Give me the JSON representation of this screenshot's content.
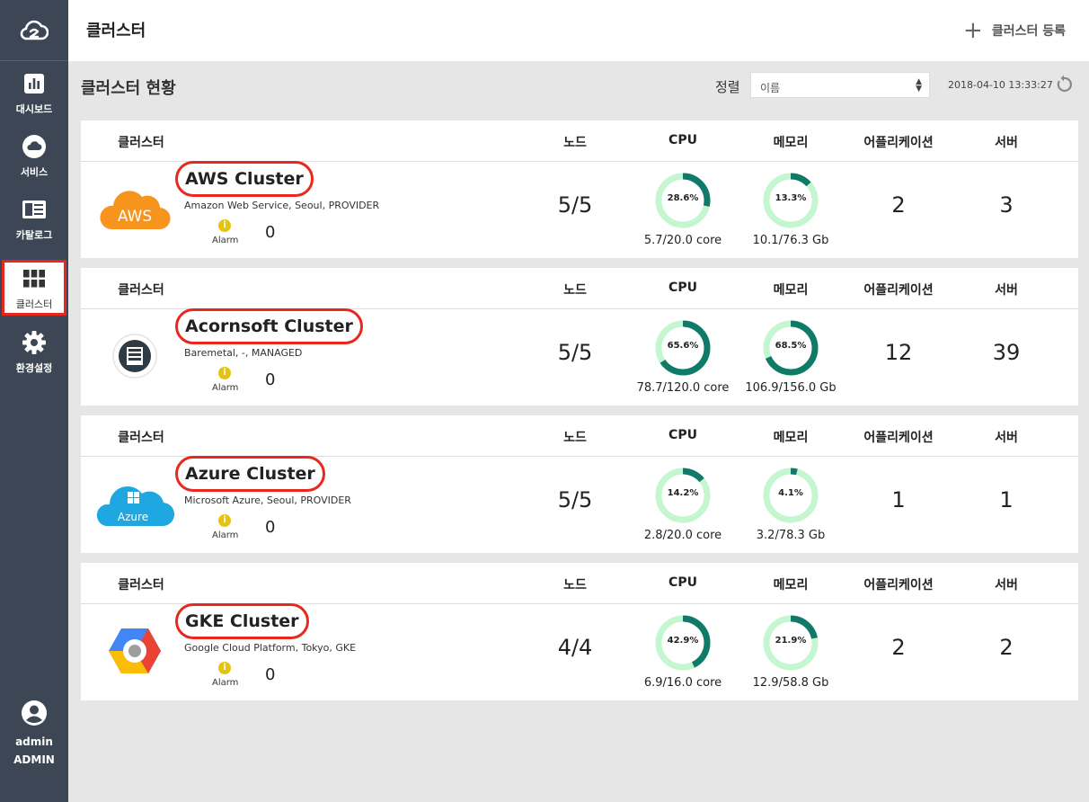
{
  "sidebar": {
    "items": [
      {
        "label": "대시보드",
        "icon": "bar-chart-icon"
      },
      {
        "label": "서비스",
        "icon": "cloud-icon"
      },
      {
        "label": "카탈로그",
        "icon": "catalog-icon"
      },
      {
        "label": "클러스터",
        "icon": "grid-icon",
        "active": true
      },
      {
        "label": "환경설정",
        "icon": "gear-icon"
      }
    ],
    "user": {
      "name": "admin",
      "role": "ADMIN"
    }
  },
  "header": {
    "title": "클러스터",
    "register_label": "클러스터 등록"
  },
  "toolbar": {
    "title": "클러스터 현황",
    "sort_label": "정렬",
    "sort_value": "이름",
    "timestamp": "2018-04-10 13:33:27"
  },
  "columns": {
    "cluster": "클러스터",
    "node": "노드",
    "cpu": "CPU",
    "memory": "메모리",
    "apps": "어플리케이션",
    "servers": "서버"
  },
  "alarm_label": "Alarm",
  "colors": {
    "sidebar": "#3c4654",
    "highlight": "#e8281e",
    "donut_track": "#c4f6d0",
    "donut_fill": "#0f7a68",
    "alarm": "#e5c40f"
  },
  "clusters": [
    {
      "name": "AWS Cluster",
      "desc": "Amazon Web Service, Seoul, PROVIDER",
      "logo": "aws-logo",
      "logo_text": "AWS",
      "alarm": "0",
      "nodes": "5/5",
      "cpu_pct": "28.6%",
      "cpu_fraction": 0.286,
      "cpu_usage": "5.7/20.0 core",
      "mem_pct": "13.3%",
      "mem_fraction": 0.133,
      "mem_usage": "10.1/76.3 Gb",
      "apps": "2",
      "servers": "3"
    },
    {
      "name": "Acornsoft Cluster",
      "desc": "Baremetal, -, MANAGED",
      "logo": "baremetal-logo",
      "logo_text": "",
      "alarm": "0",
      "nodes": "5/5",
      "cpu_pct": "65.6%",
      "cpu_fraction": 0.656,
      "cpu_usage": "78.7/120.0 core",
      "mem_pct": "68.5%",
      "mem_fraction": 0.685,
      "mem_usage": "106.9/156.0 Gb",
      "apps": "12",
      "servers": "39"
    },
    {
      "name": "Azure Cluster",
      "desc": "Microsoft Azure, Seoul, PROVIDER",
      "logo": "azure-logo",
      "logo_text": "Azure",
      "alarm": "0",
      "nodes": "5/5",
      "cpu_pct": "14.2%",
      "cpu_fraction": 0.142,
      "cpu_usage": "2.8/20.0 core",
      "mem_pct": "4.1%",
      "mem_fraction": 0.041,
      "mem_usage": "3.2/78.3 Gb",
      "apps": "1",
      "servers": "1"
    },
    {
      "name": "GKE Cluster",
      "desc": "Google Cloud Platform, Tokyo, GKE",
      "logo": "gke-logo",
      "logo_text": "",
      "alarm": "0",
      "nodes": "4/4",
      "cpu_pct": "42.9%",
      "cpu_fraction": 0.429,
      "cpu_usage": "6.9/16.0 core",
      "mem_pct": "21.9%",
      "mem_fraction": 0.219,
      "mem_usage": "12.9/58.8 Gb",
      "apps": "2",
      "servers": "2"
    }
  ]
}
